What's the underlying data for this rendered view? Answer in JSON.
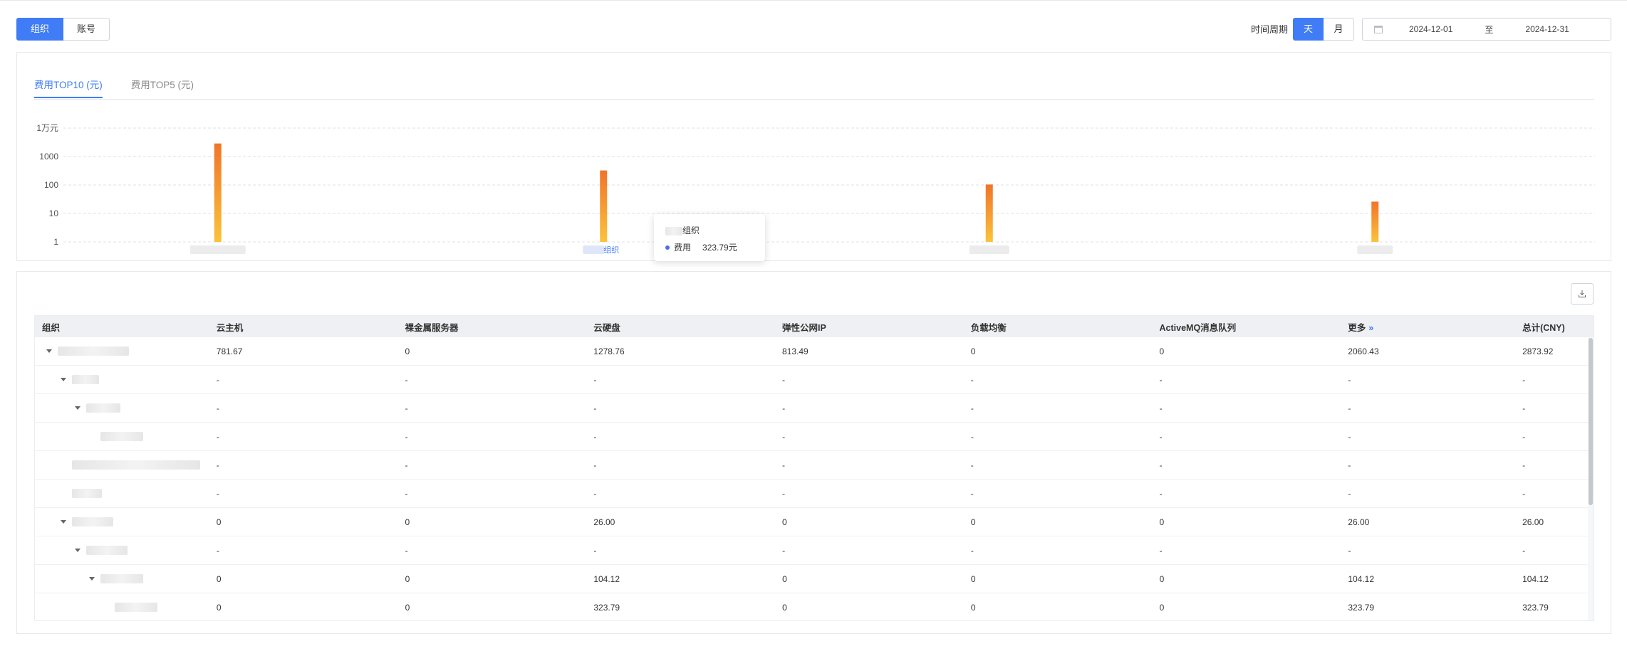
{
  "top": {
    "dim_tabs": [
      {
        "label": "组织",
        "active": true
      },
      {
        "label": "账号",
        "active": false
      }
    ],
    "period_label": "时间周期",
    "period_options": [
      {
        "label": "天",
        "active": true
      },
      {
        "label": "月",
        "active": false
      }
    ],
    "date_start": "2024-12-01",
    "date_sep": "至",
    "date_end": "2024-12-31"
  },
  "chart_card": {
    "tabs": [
      {
        "label": "费用TOP10 (元)",
        "active": true
      },
      {
        "label": "费用TOP5 (元)",
        "active": false
      }
    ],
    "tooltip": {
      "title_suffix": "组织",
      "series": "费用",
      "value": "323.79元"
    },
    "hover_label_suffix": "组织"
  },
  "chart_data": {
    "type": "bar",
    "scale": "log",
    "categories": [
      "",
      "",
      "",
      ""
    ],
    "values": [
      2873.92,
      323.79,
      104.12,
      26.0
    ],
    "yticks": [
      "1",
      "10",
      "100",
      "1000",
      "1万元"
    ],
    "ylim": [
      1,
      10000
    ],
    "grid": true,
    "colors": {
      "top": "#f0742a",
      "bottom": "#fbc33a"
    }
  },
  "table": {
    "download_icon": "download-icon",
    "columns": [
      "组织",
      "云主机",
      "裸金属服务器",
      "云硬盘",
      "弹性公网IP",
      "负载均衡",
      "ActiveMQ消息队列",
      "更多",
      "总计(CNY)"
    ],
    "more_icon": "»",
    "rows": [
      {
        "level": 0,
        "expand": true,
        "cells": [
          "781.67",
          "0",
          "1278.76",
          "813.49",
          "0",
          "0",
          "2060.43",
          "2873.92"
        ]
      },
      {
        "level": 1,
        "expand": true,
        "cells": [
          "-",
          "-",
          "-",
          "-",
          "-",
          "-",
          "-",
          "-"
        ]
      },
      {
        "level": 2,
        "expand": true,
        "cells": [
          "-",
          "-",
          "-",
          "-",
          "-",
          "-",
          "-",
          "-"
        ]
      },
      {
        "level": 3,
        "expand": false,
        "cells": [
          "-",
          "-",
          "-",
          "-",
          "-",
          "-",
          "-",
          "-"
        ]
      },
      {
        "level": 1,
        "expand": false,
        "cells": [
          "-",
          "-",
          "-",
          "-",
          "-",
          "-",
          "-",
          "-"
        ]
      },
      {
        "level": 1,
        "expand": false,
        "cells": [
          "-",
          "-",
          "-",
          "-",
          "-",
          "-",
          "-",
          "-"
        ]
      },
      {
        "level": 1,
        "expand": true,
        "cells": [
          "0",
          "0",
          "26.00",
          "0",
          "0",
          "0",
          "26.00",
          "26.00"
        ]
      },
      {
        "level": 2,
        "expand": true,
        "cells": [
          "-",
          "-",
          "-",
          "-",
          "-",
          "-",
          "-",
          "-"
        ]
      },
      {
        "level": 3,
        "expand": true,
        "cells": [
          "0",
          "0",
          "104.12",
          "0",
          "0",
          "0",
          "104.12",
          "104.12"
        ]
      },
      {
        "level": 4,
        "expand": false,
        "cells": [
          "0",
          "0",
          "323.79",
          "0",
          "0",
          "0",
          "323.79",
          "323.79"
        ]
      }
    ]
  }
}
